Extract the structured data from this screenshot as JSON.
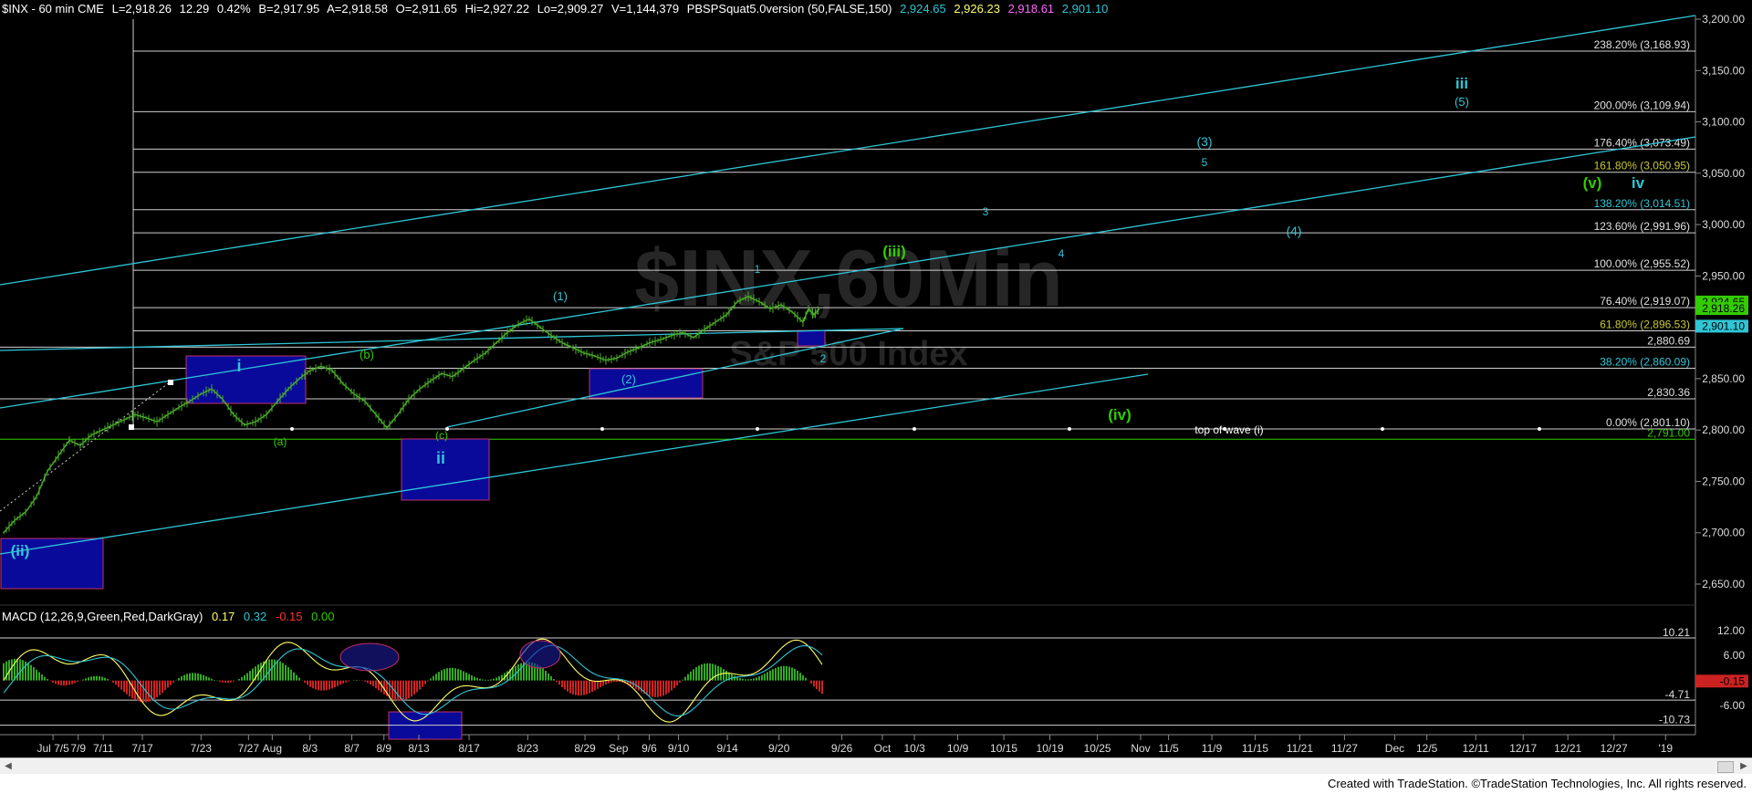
{
  "header": {
    "symbol": "$INX - 60 min  CME",
    "last": "L=2,918.26",
    "change": "12.29",
    "pct": "0.42%",
    "bid": "B=2,917.95",
    "ask": "A=2,918.58",
    "open": "O=2,911.65",
    "high": "Hi=2,927.22",
    "low": "Lo=2,909.27",
    "volume": "V=1,144,379",
    "indicator": "PBSPSquat5.0version (50,FALSE,150)",
    "v1": "2,924.65",
    "v2": "2,926.23",
    "v3": "2,918.61",
    "v4": "2,901.10"
  },
  "watermark": {
    "title": "$INX,60Min",
    "subtitle": "S&P 500 Index"
  },
  "macd_header": {
    "label": "MACD (12,26,9,Green,Red,DarkGray)",
    "v1": "0.17",
    "v2": "0.32",
    "v3": "-0.15",
    "v4": "0.00"
  },
  "footer": {
    "credit": "Created with TradeStation. ©TradeStation Technologies, Inc. All rights reserved."
  },
  "colors": {
    "bg": "#000000",
    "price": "#4caf2a",
    "cyan": "#2fc6d6",
    "fib": "#ffffff",
    "box": "#0a0a9a",
    "boxborder": "#c0306a",
    "green_label": "#33cc00",
    "yellow": "#c8c832"
  },
  "chart_data": {
    "type": "line",
    "title": "$INX,60Min",
    "subtitle": "S&P 500 Index",
    "x_ticks": [
      "Jul 7/5",
      "7/9",
      "7/11",
      "7/17",
      "7/23",
      "7/27",
      "Aug",
      "8/3",
      "8/7",
      "8/9",
      "8/13",
      "8/17",
      "8/23",
      "8/29",
      "Sep",
      "9/6",
      "9/10",
      "9/14",
      "9/20",
      "9/26",
      "Oct",
      "10/3",
      "10/9",
      "10/15",
      "10/19",
      "10/25",
      "Nov",
      "11/5",
      "11/9",
      "11/15",
      "11/21",
      "11/27",
      "Dec",
      "12/5",
      "12/11",
      "12/17",
      "12/21",
      "12/27",
      "'19"
    ],
    "y_ticks": [
      "3,200.00",
      "3,150.00",
      "3,100.00",
      "3,050.00",
      "3,000.00",
      "2,950.00",
      "2,900.00",
      "2,850.00",
      "2,800.00",
      "2,750.00",
      "2,700.00",
      "2,650.00"
    ],
    "ylim": [
      2600,
      3210
    ],
    "price_series": {
      "name": "$INX",
      "points": [
        {
          "i": 0,
          "v": 2700
        },
        {
          "i": 4,
          "v": 2712
        },
        {
          "i": 8,
          "v": 2720
        },
        {
          "i": 12,
          "v": 2735
        },
        {
          "i": 16,
          "v": 2760
        },
        {
          "i": 20,
          "v": 2775
        },
        {
          "i": 24,
          "v": 2790
        },
        {
          "i": 28,
          "v": 2785
        },
        {
          "i": 32,
          "v": 2795
        },
        {
          "i": 36,
          "v": 2800
        },
        {
          "i": 40,
          "v": 2805
        },
        {
          "i": 44,
          "v": 2810
        },
        {
          "i": 48,
          "v": 2815
        },
        {
          "i": 52,
          "v": 2812
        },
        {
          "i": 56,
          "v": 2808
        },
        {
          "i": 60,
          "v": 2815
        },
        {
          "i": 64,
          "v": 2822
        },
        {
          "i": 68,
          "v": 2828
        },
        {
          "i": 72,
          "v": 2835
        },
        {
          "i": 76,
          "v": 2840
        },
        {
          "i": 80,
          "v": 2830
        },
        {
          "i": 84,
          "v": 2815
        },
        {
          "i": 88,
          "v": 2805
        },
        {
          "i": 92,
          "v": 2808
        },
        {
          "i": 96,
          "v": 2815
        },
        {
          "i": 100,
          "v": 2828
        },
        {
          "i": 104,
          "v": 2840
        },
        {
          "i": 108,
          "v": 2850
        },
        {
          "i": 112,
          "v": 2858
        },
        {
          "i": 116,
          "v": 2862
        },
        {
          "i": 120,
          "v": 2858
        },
        {
          "i": 124,
          "v": 2845
        },
        {
          "i": 128,
          "v": 2835
        },
        {
          "i": 132,
          "v": 2828
        },
        {
          "i": 136,
          "v": 2815
        },
        {
          "i": 140,
          "v": 2802
        },
        {
          "i": 144,
          "v": 2815
        },
        {
          "i": 148,
          "v": 2830
        },
        {
          "i": 152,
          "v": 2840
        },
        {
          "i": 156,
          "v": 2848
        },
        {
          "i": 160,
          "v": 2855
        },
        {
          "i": 164,
          "v": 2852
        },
        {
          "i": 168,
          "v": 2860
        },
        {
          "i": 172,
          "v": 2868
        },
        {
          "i": 176,
          "v": 2875
        },
        {
          "i": 180,
          "v": 2885
        },
        {
          "i": 184,
          "v": 2895
        },
        {
          "i": 188,
          "v": 2903
        },
        {
          "i": 192,
          "v": 2908
        },
        {
          "i": 196,
          "v": 2900
        },
        {
          "i": 200,
          "v": 2892
        },
        {
          "i": 204,
          "v": 2885
        },
        {
          "i": 208,
          "v": 2880
        },
        {
          "i": 212,
          "v": 2875
        },
        {
          "i": 216,
          "v": 2872
        },
        {
          "i": 220,
          "v": 2868
        },
        {
          "i": 224,
          "v": 2870
        },
        {
          "i": 228,
          "v": 2876
        },
        {
          "i": 232,
          "v": 2880
        },
        {
          "i": 236,
          "v": 2885
        },
        {
          "i": 240,
          "v": 2888
        },
        {
          "i": 244,
          "v": 2892
        },
        {
          "i": 248,
          "v": 2895
        },
        {
          "i": 252,
          "v": 2890
        },
        {
          "i": 256,
          "v": 2898
        },
        {
          "i": 260,
          "v": 2905
        },
        {
          "i": 264,
          "v": 2912
        },
        {
          "i": 268,
          "v": 2925
        },
        {
          "i": 272,
          "v": 2930
        },
        {
          "i": 276,
          "v": 2925
        },
        {
          "i": 280,
          "v": 2918
        },
        {
          "i": 284,
          "v": 2922
        },
        {
          "i": 288,
          "v": 2915
        },
        {
          "i": 292,
          "v": 2905
        },
        {
          "i": 294,
          "v": 2918
        },
        {
          "i": 296,
          "v": 2912
        },
        {
          "i": 298,
          "v": 2918
        }
      ]
    },
    "fib_levels": [
      {
        "label": "238.20% (3,168.93)",
        "value": 3168.93
      },
      {
        "label": "200.00% (3,109.94)",
        "value": 3109.94
      },
      {
        "label": "176.40% (3,073.49)",
        "value": 3073.49
      },
      {
        "label": "161.80% (3,050.95)",
        "value": 3050.95
      },
      {
        "label": "138.20% (3,014.51)",
        "value": 3014.51
      },
      {
        "label": "123.60% (2,991.96)",
        "value": 2991.96
      },
      {
        "label": "100.00% (2,955.52)",
        "value": 2955.52
      },
      {
        "label": "76.40% (2,919.07)",
        "value": 2919.07
      },
      {
        "label": "61.80% (2,896.53)",
        "value": 2896.53
      },
      {
        "label": "2,880.69",
        "value": 2880.69
      },
      {
        "label": "38.20% (2,860.09)",
        "value": 2860.09
      },
      {
        "label": "2,830.36",
        "value": 2830.36
      },
      {
        "label": "0.00% (2,801.10)",
        "value": 2801.1
      },
      {
        "label": "2,791.00",
        "value": 2791.0
      }
    ],
    "price_tags": [
      {
        "label": "2,924.65",
        "value": 2924.65
      },
      {
        "label": "2,918.26",
        "value": 2918.26
      },
      {
        "label": "2,901.10",
        "value": 2901.1
      }
    ],
    "wave_labels": [
      {
        "text": "(ii)",
        "color": "cyan",
        "bold": true
      },
      {
        "text": "i",
        "color": "cyan",
        "bold": true
      },
      {
        "text": "(a)",
        "color": "green"
      },
      {
        "text": "(b)",
        "color": "green"
      },
      {
        "text": "(c)",
        "color": "green"
      },
      {
        "text": "ii",
        "color": "cyan",
        "bold": true
      },
      {
        "text": "(1)",
        "color": "cyan"
      },
      {
        "text": "(2)",
        "color": "cyan"
      },
      {
        "text": "1",
        "color": "cyan"
      },
      {
        "text": "2",
        "color": "cyan"
      },
      {
        "text": "3",
        "color": "cyan"
      },
      {
        "text": "4",
        "color": "cyan"
      },
      {
        "text": "(3)",
        "color": "cyan"
      },
      {
        "text": "5",
        "color": "cyan"
      },
      {
        "text": "(4)",
        "color": "cyan"
      },
      {
        "text": "(5)",
        "color": "cyan"
      },
      {
        "text": "iii",
        "color": "cyan",
        "bold": true
      },
      {
        "text": "iv",
        "color": "cyan",
        "bold": true
      },
      {
        "text": "(iii)",
        "color": "green",
        "bold": true
      },
      {
        "text": "(iv)",
        "color": "green",
        "bold": true
      },
      {
        "text": "(v)",
        "color": "green",
        "bold": true
      },
      {
        "text": "top of wave (i)",
        "color": "white"
      }
    ],
    "macd": {
      "y_ticks": [
        "12.00",
        "6.00",
        "-6.00"
      ],
      "ref_levels": [
        {
          "label": "10.21",
          "value": 10.21
        },
        {
          "label": "-4.71",
          "value": -4.71
        },
        {
          "label": "-10.73",
          "value": -10.73
        }
      ],
      "last_tag": "-0.15",
      "ylim": [
        -13,
        17
      ]
    }
  }
}
